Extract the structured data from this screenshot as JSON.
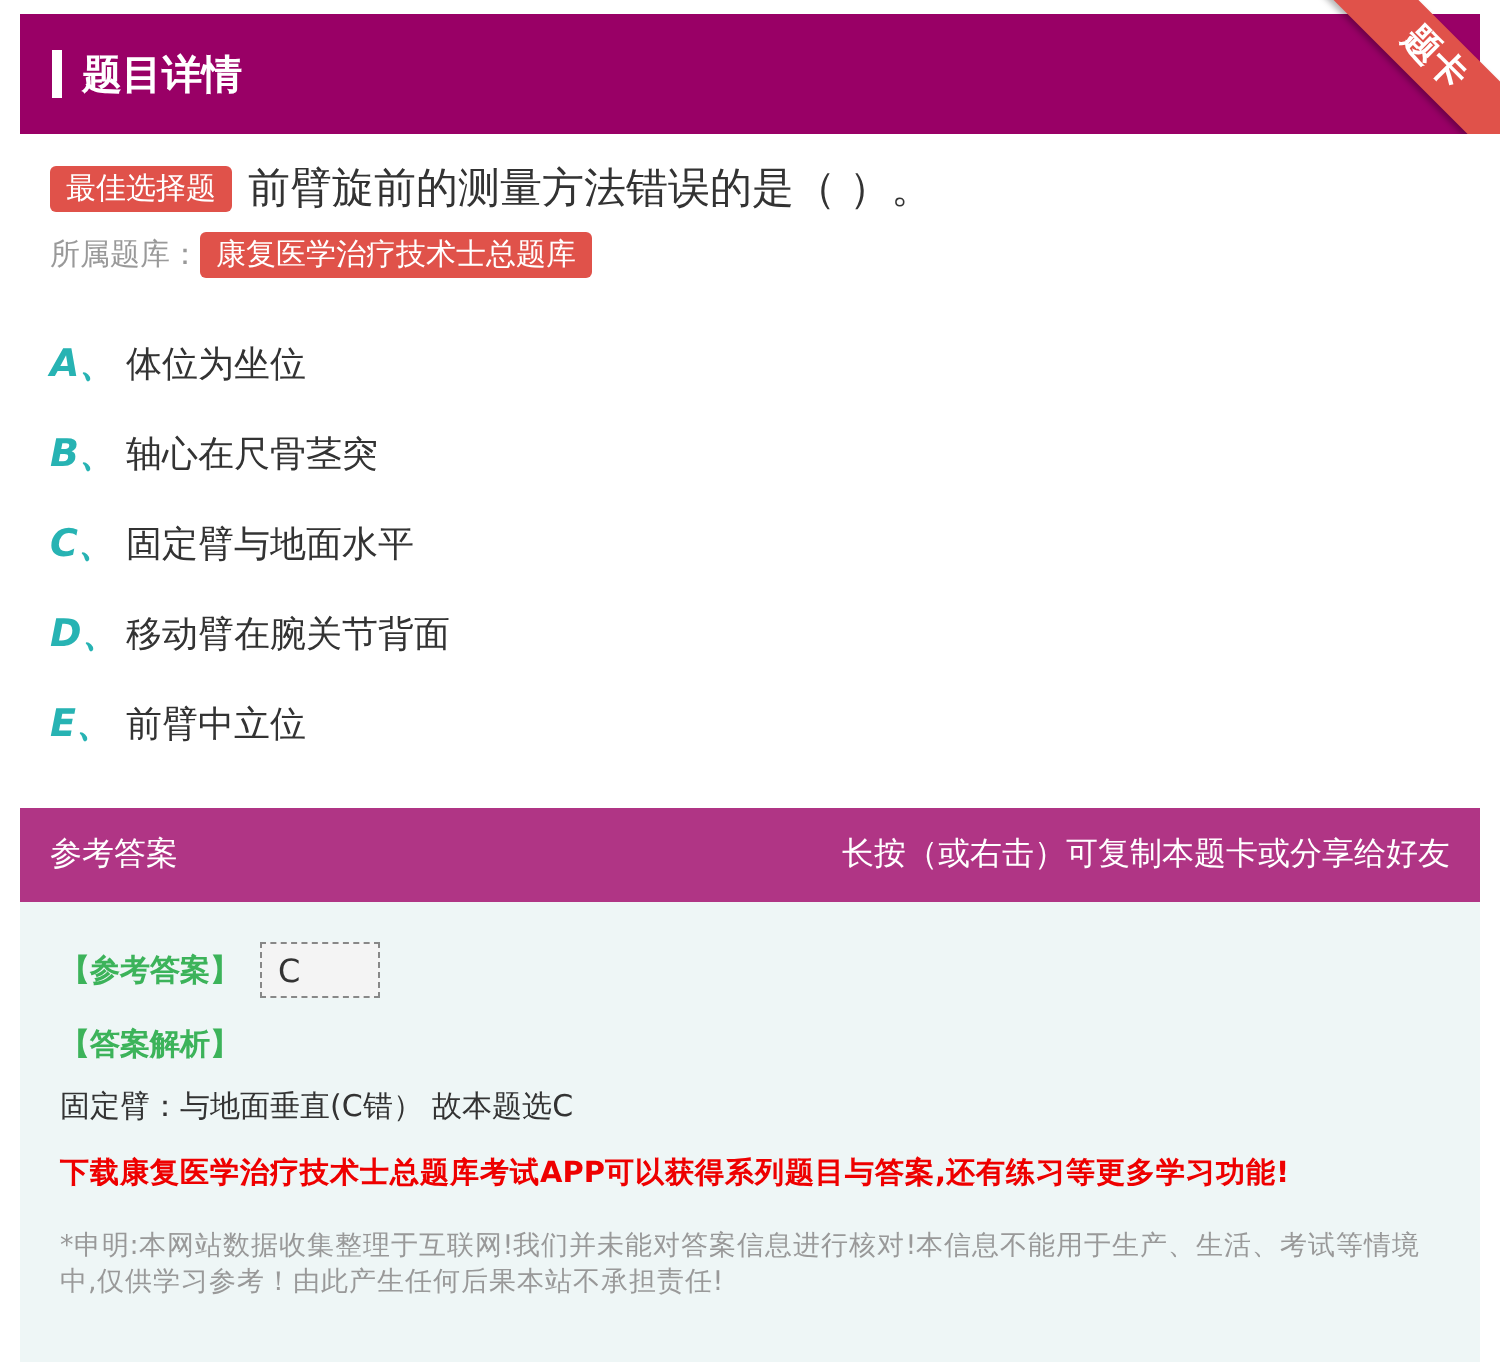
{
  "header": {
    "title": "题目详情",
    "ribbon": "题卡"
  },
  "question": {
    "type_badge": "最佳选择题",
    "text": "前臂旋前的测量方法错误的是（ ）。",
    "bank_label": "所属题库：",
    "bank": "康复医学治疗技术士总题库"
  },
  "options": [
    {
      "letter": "A、",
      "text": "体位为坐位"
    },
    {
      "letter": "B、",
      "text": "轴心在尺骨茎突"
    },
    {
      "letter": "C、",
      "text": "固定臂与地面水平"
    },
    {
      "letter": "D、",
      "text": "移动臂在腕关节背面"
    },
    {
      "letter": "E、",
      "text": "前臂中立位"
    }
  ],
  "answer": {
    "title": "参考答案",
    "hint": "长按（或右击）可复制本题卡或分享给好友",
    "answer_label": "【参考答案】",
    "answer_value": "C",
    "analysis_label": "【答案解析】",
    "analysis": "固定臂：与地面垂直(C错） 故本题选C",
    "promo": "下载康复医学治疗技术士总题库考试APP可以获得系列题目与答案,还有练习等更多学习功能!",
    "disclaimer": "*申明:本网站数据收集整理于互联网!我们并未能对答案信息进行核对!本信息不能用于生产、生活、考试等情境中,仅供学习参考！由此产生任何后果本站不承担责任!"
  }
}
